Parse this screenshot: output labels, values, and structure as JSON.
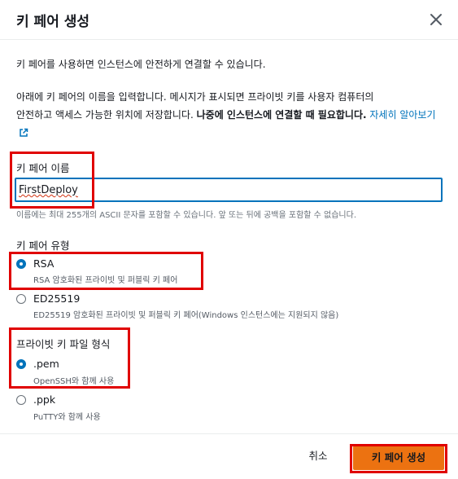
{
  "dialog": {
    "title": "키 페어 생성",
    "intro": "키 페어를 사용하면 인스턴스에 안전하게 연결할 수 있습니다.",
    "desc_line1": "아래에 키 페어의 이름을 입력합니다. 메시지가 표시되면 프라이빗 키를 사용자 컴퓨터의",
    "desc_line2_plain": "안전하고 액세스 가능한 위치에 저장합니다. ",
    "desc_line2_bold": "나중에 인스턴스에 연결할 때 필요합니다.",
    "learn_more_link": "자세히 알아보기"
  },
  "key_name": {
    "label": "키 페어 이름",
    "value": "FirstDeploy",
    "helper": "이름에는 최대 255개의 ASCII 문자를 포함할 수 있습니다. 앞 또는 뒤에 공백을 포함할 수 없습니다."
  },
  "key_type": {
    "label": "키 페어 유형",
    "options": [
      {
        "title": "RSA",
        "desc": "RSA 암호화된 프라이빗 및 퍼블릭 키 페어",
        "selected": true
      },
      {
        "title": "ED25519",
        "desc": "ED25519 암호화된 프라이빗 및 퍼블릭 키 페어(Windows 인스턴스에는 지원되지 않음)",
        "selected": false
      }
    ]
  },
  "key_format": {
    "label": "프라이빗 키 파일 형식",
    "options": [
      {
        "title": ".pem",
        "desc": "OpenSSH와 함께 사용",
        "selected": true
      },
      {
        "title": ".ppk",
        "desc": "PuTTY와 함께 사용",
        "selected": false
      }
    ]
  },
  "footer": {
    "cancel_label": "취소",
    "create_label": "키 페어 생성"
  },
  "colors": {
    "accent": "#0073bb",
    "primary_button": "#ec7211",
    "highlight_box": "#e00000"
  }
}
